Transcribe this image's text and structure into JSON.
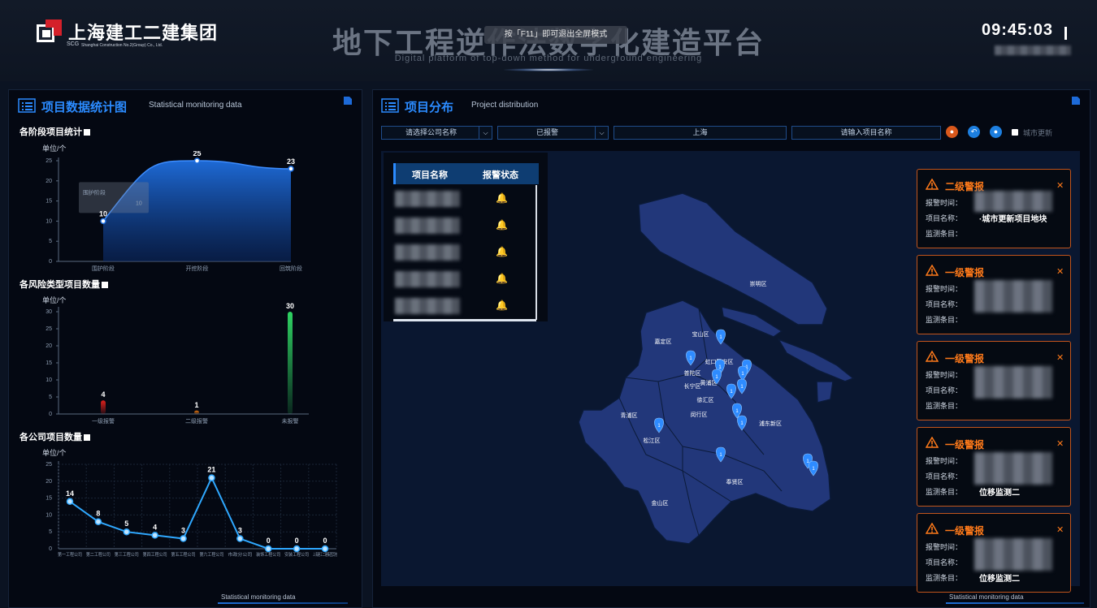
{
  "header": {
    "logo_text": "上海建工二建集团",
    "logo_abbr": "SCG",
    "logo_en": "Shanghai Construction No.2(Group) Co., Ltd.",
    "title": "地下工程逆作法数字化建造平台",
    "subtitle": "Digital platform of top-down method for underground engineering",
    "fullscreen_hint": "按「F11」即可退出全屏模式",
    "clock": "09:45:03"
  },
  "left_panel": {
    "title": "项目数据统计图",
    "title_en": "Statistical monitoring data",
    "bottom_tab": "Statistical monitoring data"
  },
  "right_panel": {
    "title": "项目分布",
    "title_en": "Project distribution",
    "bottom_tab": "Statistical monitoring data",
    "filters": {
      "company_placeholder": "请选择公司名称",
      "status_value": "已报警",
      "city_value": "上海",
      "project_placeholder": "请输入项目名称",
      "city_update_label": "城市更新"
    },
    "table": {
      "headers": [
        "项目名称",
        "报警状态"
      ],
      "row_count": 5
    },
    "alerts": [
      {
        "level": "二级警报",
        "time_label": "报警时间：",
        "project_label": "项目名称：",
        "project_value": "·城市更新项目地块",
        "item_label": "监测条目：",
        "item_value": ""
      },
      {
        "level": "一级警报",
        "time_label": "报警时间：",
        "project_label": "项目名称：",
        "project_value": "",
        "item_label": "监测条目：",
        "item_value": ""
      },
      {
        "level": "一级警报",
        "time_label": "报警时间：",
        "project_label": "项目名称：",
        "project_value": "",
        "item_label": "监测条目：",
        "item_value": ""
      },
      {
        "level": "一级警报",
        "time_label": "报警时间：",
        "project_label": "项目名称：",
        "project_value": "",
        "item_label": "监测条目：",
        "item_value": "位移监测二"
      },
      {
        "level": "一级警报",
        "time_label": "报警时间：",
        "project_label": "项目名称：",
        "project_value": "",
        "item_label": "监测条目：",
        "item_value": "位移监测二"
      }
    ],
    "districts": [
      "崇明区",
      "宝山区",
      "嘉定区",
      "虹口区",
      "普陀区",
      "静安区",
      "长宁区",
      "黄浦区",
      "徐汇区",
      "闵行区",
      "青浦区",
      "浦东新区",
      "松江区",
      "奉贤区",
      "金山区"
    ],
    "marker_label": "1"
  },
  "chart_data": [
    {
      "type": "area",
      "title": "各阶段项目统计",
      "unit": "单位/个",
      "categories": [
        "围护阶段",
        "开挖阶段",
        "回筑阶段"
      ],
      "values": [
        10,
        25,
        23
      ],
      "ylim": [
        0,
        25
      ],
      "yticks": [
        0,
        5,
        10,
        15,
        20,
        25
      ],
      "color": "#1f6fe0",
      "tooltip": {
        "category": "围护阶段",
        "value": 10
      }
    },
    {
      "type": "bar",
      "title": "各风险类型项目数量",
      "unit": "单位/个",
      "categories": [
        "一级报警",
        "二级报警",
        "未报警"
      ],
      "values": [
        4,
        1,
        30
      ],
      "ylim": [
        0,
        30
      ],
      "yticks": [
        0,
        5,
        10,
        15,
        20,
        25,
        30
      ],
      "colors": [
        "#e0201b",
        "#f07a10",
        "#2fd463"
      ]
    },
    {
      "type": "line",
      "title": "各公司项目数量",
      "unit": "单位/个",
      "categories": [
        "第一工程公司",
        "第二工程公司",
        "第三工程公司",
        "第四工程公司",
        "第五工程公司",
        "第六工程公司",
        "市政分公司",
        "装饰工程公司",
        "安装工程公司",
        "上海建工二建集团其他"
      ],
      "values": [
        14,
        8,
        5,
        4,
        3,
        21,
        3,
        0,
        0,
        0
      ],
      "ylim": [
        0,
        25
      ],
      "yticks": [
        0,
        5,
        10,
        15,
        20,
        25
      ],
      "color": "#2fa8ff"
    }
  ]
}
